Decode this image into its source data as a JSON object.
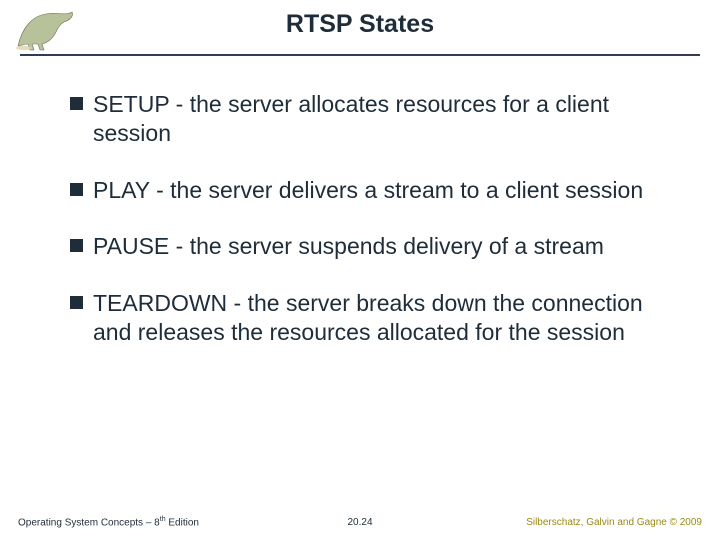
{
  "title": "RTSP States",
  "bullets": [
    "SETUP - the server allocates resources for a client session",
    "PLAY - the server delivers a stream to a client session",
    "PAUSE - the server suspends delivery of a stream",
    "TEARDOWN - the server breaks down the connection and releases the resources allocated for the session"
  ],
  "footer": {
    "left_pre": "Operating System Concepts – 8",
    "left_sup": "th",
    "left_post": " Edition",
    "center": "20.24",
    "right": "Silberschatz, Galvin and Gagne © 2009"
  }
}
